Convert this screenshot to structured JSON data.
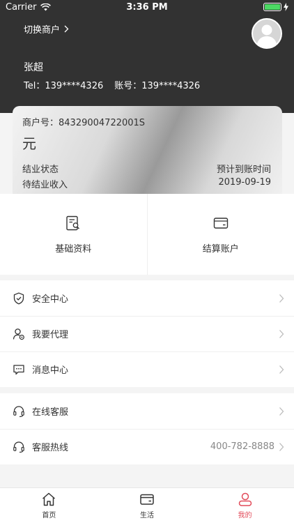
{
  "status_bar": {
    "carrier": "Carrier",
    "time": "3:36 PM"
  },
  "header": {
    "switch_merchant": "切换商户",
    "user_name": "张超",
    "tel": "Tel：139****4326",
    "account": "账号：139****4326"
  },
  "card": {
    "merchant_no": "商户号：84329004722001S",
    "amount": "元",
    "settled_status_label": "结业状态",
    "expected_time_label": "预计到账时间",
    "pending_income_label": "待结业收入",
    "expected_date": "2019-09-19"
  },
  "quick": [
    {
      "label": "基础资料",
      "icon": "profile-doc-icon"
    },
    {
      "label": "结算账户",
      "icon": "card-wallet-icon"
    }
  ],
  "menu_group1": [
    {
      "label": "安全中心",
      "icon": "shield-icon"
    },
    {
      "label": "我要代理",
      "icon": "agent-icon"
    },
    {
      "label": "消息中心",
      "icon": "message-icon"
    }
  ],
  "menu_group2": [
    {
      "label": "在线客服",
      "icon": "headset-icon"
    },
    {
      "label": "客服热线",
      "icon": "headset-icon",
      "value": "400-782-8888"
    }
  ],
  "tabbar": [
    {
      "label": "首页",
      "icon": "home-icon"
    },
    {
      "label": "生活",
      "icon": "wallet-icon"
    },
    {
      "label": "我的",
      "icon": "user-icon",
      "active": true
    }
  ],
  "colors": {
    "header_bg": "#323232",
    "accent": "#e24b5a",
    "battery": "#4cd964"
  }
}
